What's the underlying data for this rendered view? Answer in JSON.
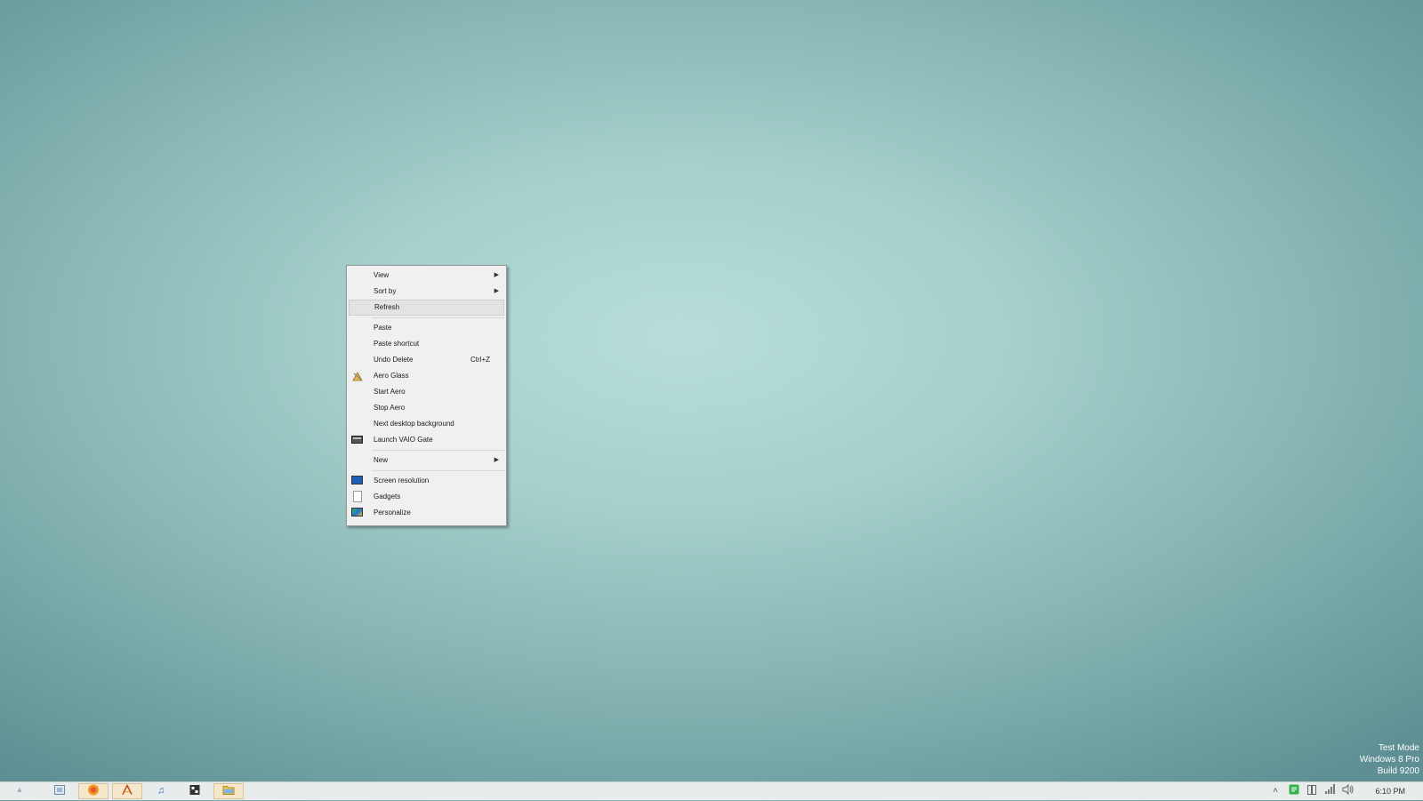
{
  "context_menu": {
    "items": [
      {
        "label": "View"
      },
      {
        "label": "Sort by"
      },
      {
        "label": "Refresh"
      },
      {
        "label": "Paste"
      },
      {
        "label": "Paste shortcut"
      },
      {
        "label": "Undo Delete",
        "shortcut": "Ctrl+Z"
      },
      {
        "label": "Aero Glass",
        "icon": "aero-glass-icon"
      },
      {
        "label": "Start Aero"
      },
      {
        "label": "Stop Aero"
      },
      {
        "label": "Next desktop background"
      },
      {
        "label": "Launch VAIO Gate",
        "icon": "vaio-gate-icon"
      },
      {
        "label": "New"
      },
      {
        "label": "Screen resolution",
        "icon": "monitor-icon"
      },
      {
        "label": "Gadgets",
        "icon": "gadgets-icon"
      },
      {
        "label": "Personalize",
        "icon": "personalize-icon"
      }
    ],
    "highlighted": "Refresh"
  },
  "watermark": {
    "line1": "Test Mode",
    "line2": "Windows 8 Pro",
    "line3": "Build 9200"
  },
  "taskbar": {
    "apps": [
      {
        "icon": "file-explorer-icon"
      },
      {
        "icon": "firefox-icon"
      },
      {
        "icon": "app-a-icon"
      },
      {
        "icon": "music-note-icon"
      },
      {
        "icon": "media-app-icon"
      },
      {
        "icon": "folder-icon"
      }
    ],
    "tray_icons": [
      "show-hidden-icons-chevron",
      "green-app-icon",
      "network-adapter-icon",
      "signal-bars-icon",
      "speaker-icon"
    ],
    "clock": "6:10 PM"
  },
  "colors": {
    "desktop_center": "#b7ddd9",
    "desktop_edge": "#5e8f94",
    "menu_bg": "#f0f0f0",
    "taskbar_bg": "#e9ecec"
  }
}
